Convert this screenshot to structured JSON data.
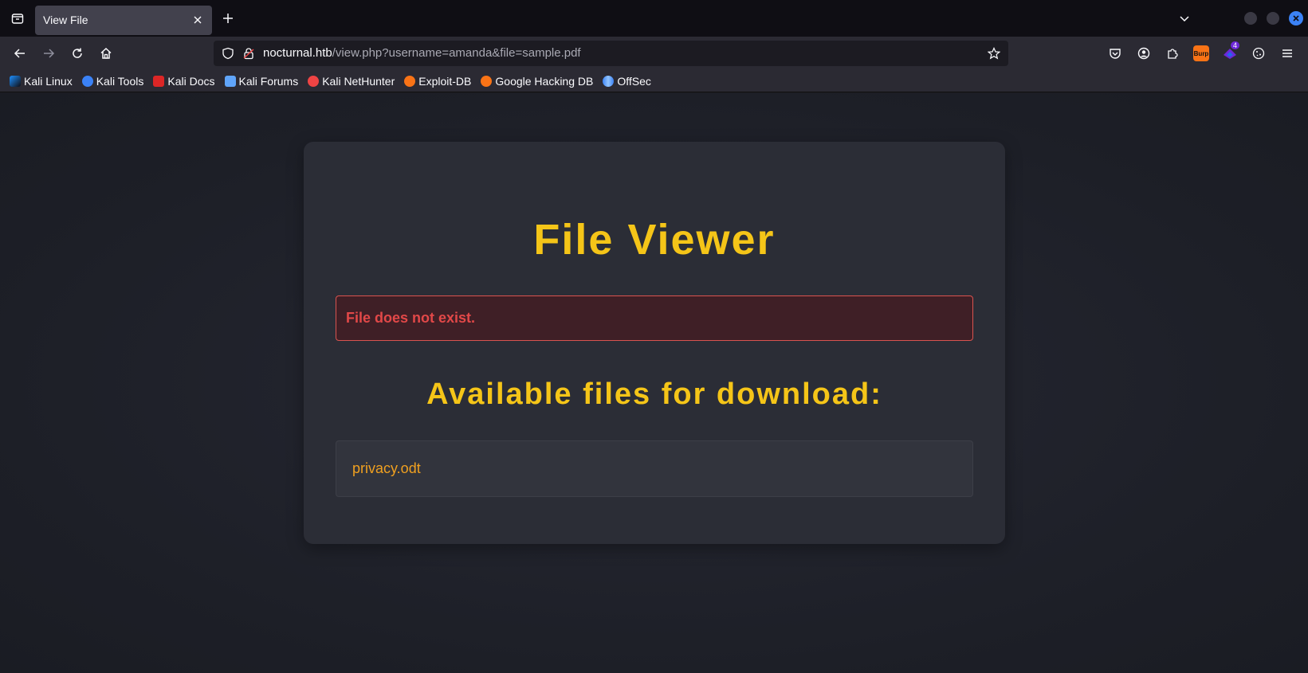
{
  "browser": {
    "tab_title": "View File",
    "url": {
      "host": "nocturnal.htb",
      "path": "/view.php?username=amanda&file=sample.pdf"
    },
    "extensions": {
      "burp_label": "Burp",
      "badge_count": "4"
    },
    "bookmarks": [
      {
        "label": "Kali Linux",
        "color": "#1e90ff"
      },
      {
        "label": "Kali Tools",
        "color": "#3b82f6"
      },
      {
        "label": "Kali Docs",
        "color": "#dc2626"
      },
      {
        "label": "Kali Forums",
        "color": "#60a5fa"
      },
      {
        "label": "Kali NetHunter",
        "color": "#ef4444"
      },
      {
        "label": "Exploit-DB",
        "color": "#f97316"
      },
      {
        "label": "Google Hacking DB",
        "color": "#f97316"
      },
      {
        "label": "OffSec",
        "color": "#3b82f6"
      }
    ]
  },
  "page": {
    "title": "File Viewer",
    "error_message": "File does not exist.",
    "files_heading": "Available files for download:",
    "files": [
      {
        "name": "privacy.odt"
      }
    ],
    "colors": {
      "accent": "#f5c518",
      "error_text": "#e24848",
      "link": "#f0a020"
    }
  }
}
